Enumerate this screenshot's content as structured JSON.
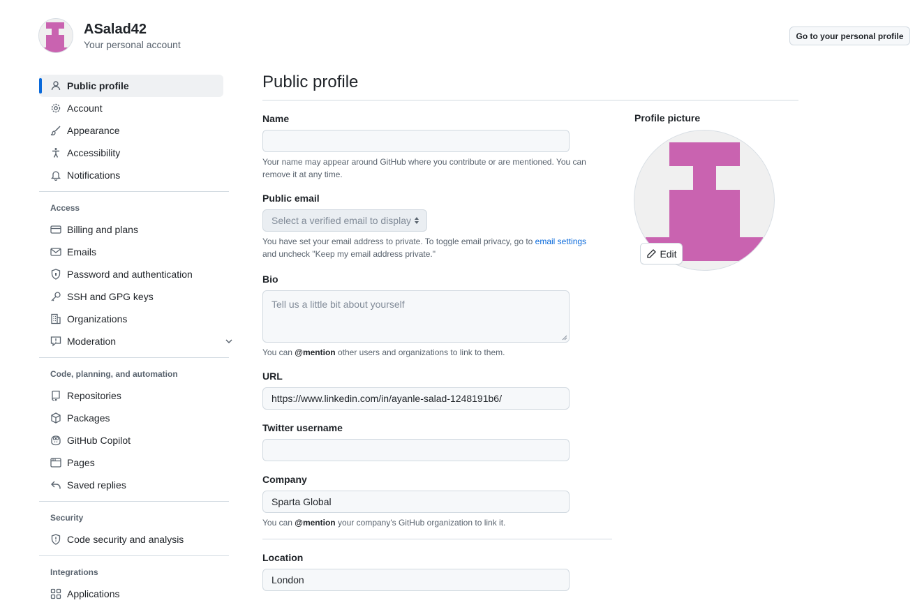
{
  "header": {
    "username": "ASalad42",
    "subtitle": "Your personal account",
    "go_profile_label": "Go to your personal profile"
  },
  "sidebar": {
    "top_items": [
      {
        "label": "Public profile",
        "icon": "person-icon",
        "active": true
      },
      {
        "label": "Account",
        "icon": "gear-icon"
      },
      {
        "label": "Appearance",
        "icon": "paintbrush-icon"
      },
      {
        "label": "Accessibility",
        "icon": "accessibility-icon"
      },
      {
        "label": "Notifications",
        "icon": "bell-icon"
      }
    ],
    "access_heading": "Access",
    "access_items": [
      {
        "label": "Billing and plans",
        "icon": "credit-card-icon"
      },
      {
        "label": "Emails",
        "icon": "mail-icon"
      },
      {
        "label": "Password and authentication",
        "icon": "shield-lock-icon"
      },
      {
        "label": "SSH and GPG keys",
        "icon": "key-icon"
      },
      {
        "label": "Organizations",
        "icon": "organization-icon"
      },
      {
        "label": "Moderation",
        "icon": "report-icon"
      }
    ],
    "code_heading": "Code, planning, and automation",
    "code_items": [
      {
        "label": "Repositories",
        "icon": "repo-icon"
      },
      {
        "label": "Packages",
        "icon": "package-icon"
      },
      {
        "label": "GitHub Copilot",
        "icon": "copilot-icon"
      },
      {
        "label": "Pages",
        "icon": "browser-icon"
      },
      {
        "label": "Saved replies",
        "icon": "reply-icon"
      }
    ],
    "security_heading": "Security",
    "security_items": [
      {
        "label": "Code security and analysis",
        "icon": "shield-icon"
      }
    ],
    "integrations_heading": "Integrations",
    "integrations_items": [
      {
        "label": "Applications",
        "icon": "apps-icon"
      }
    ]
  },
  "main": {
    "title": "Public profile",
    "name": {
      "label": "Name",
      "value": "",
      "note": "Your name may appear around GitHub where you contribute or are mentioned. You can remove it at any time."
    },
    "public_email": {
      "label": "Public email",
      "selected": "Select a verified email to display",
      "note_before": "You have set your email address to private. To toggle email privacy, go to ",
      "note_link": "email settings",
      "note_after": " and uncheck \"Keep my email address private.\""
    },
    "bio": {
      "label": "Bio",
      "placeholder": "Tell us a little bit about yourself",
      "note_before": "You can ",
      "note_mention": "@mention",
      "note_after": " other users and organizations to link to them."
    },
    "url": {
      "label": "URL",
      "value": "https://www.linkedin.com/in/ayanle-salad-1248191b6/"
    },
    "twitter": {
      "label": "Twitter username",
      "value": ""
    },
    "company": {
      "label": "Company",
      "value": "Sparta Global",
      "note_before": "You can ",
      "note_mention": "@mention",
      "note_after": " your company's GitHub organization to link it."
    },
    "location": {
      "label": "Location",
      "value": "London"
    }
  },
  "profile_picture": {
    "label": "Profile picture",
    "edit_label": "Edit",
    "identicon_color": "#c963b0"
  },
  "colors": {
    "accent": "#0969da",
    "border": "#d1d9e0",
    "muted_text": "#59636e"
  }
}
